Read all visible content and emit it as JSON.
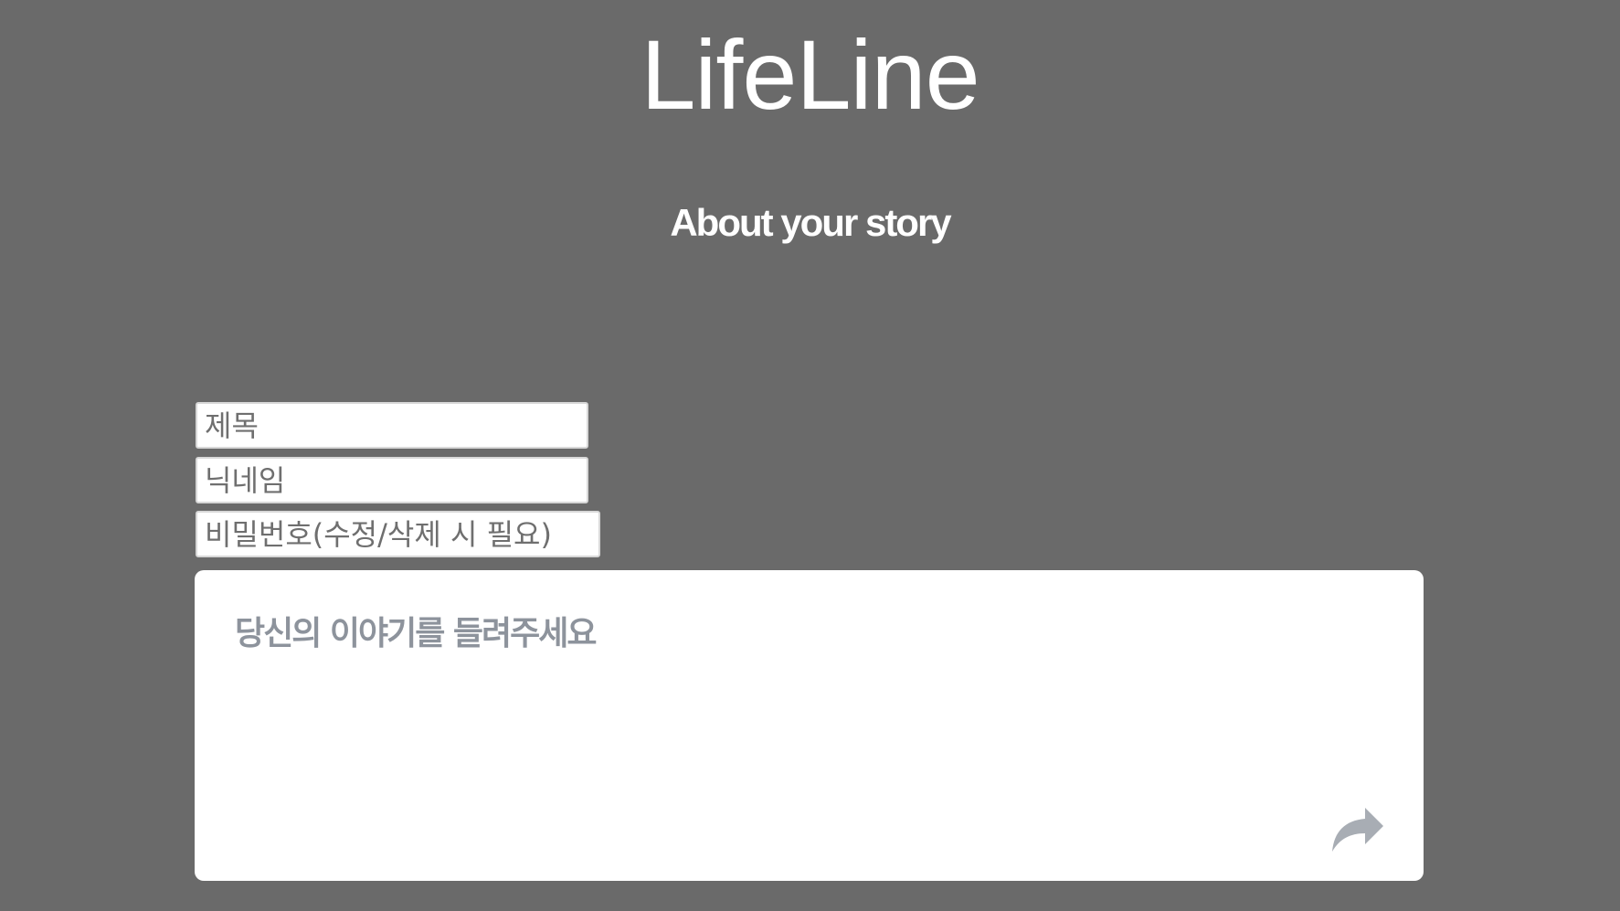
{
  "header": {
    "title": "LifeLine",
    "subtitle": "About your story"
  },
  "form": {
    "title_placeholder": "제목",
    "nickname_placeholder": "닉네임",
    "password_placeholder": "비밀번호(수정/삭제 시 필요)",
    "story_placeholder": "당신의 이야기를 들려주세요",
    "submit_icon": "share-arrow-icon"
  },
  "colors": {
    "background": "#6a6a6a",
    "text": "#ffffff",
    "placeholder": "#8d939c",
    "icon": "#a8adb4"
  }
}
